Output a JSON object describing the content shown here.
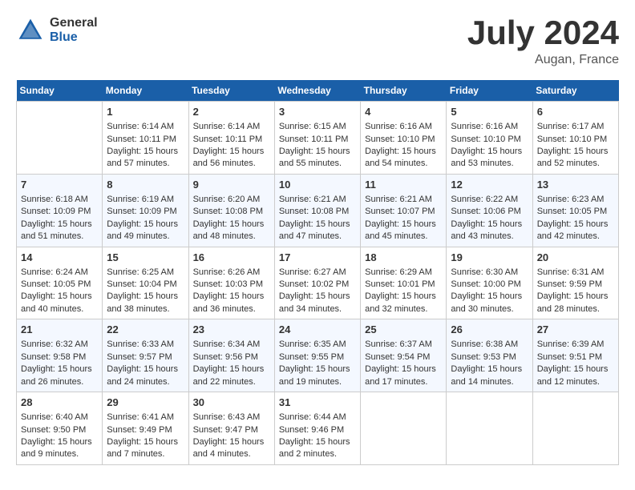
{
  "header": {
    "logo_general": "General",
    "logo_blue": "Blue",
    "month_title": "July 2024",
    "location": "Augan, France"
  },
  "days_of_week": [
    "Sunday",
    "Monday",
    "Tuesday",
    "Wednesday",
    "Thursday",
    "Friday",
    "Saturday"
  ],
  "weeks": [
    [
      {
        "day": "",
        "info": ""
      },
      {
        "day": "1",
        "info": "Sunrise: 6:14 AM\nSunset: 10:11 PM\nDaylight: 15 hours\nand 57 minutes."
      },
      {
        "day": "2",
        "info": "Sunrise: 6:14 AM\nSunset: 10:11 PM\nDaylight: 15 hours\nand 56 minutes."
      },
      {
        "day": "3",
        "info": "Sunrise: 6:15 AM\nSunset: 10:11 PM\nDaylight: 15 hours\nand 55 minutes."
      },
      {
        "day": "4",
        "info": "Sunrise: 6:16 AM\nSunset: 10:10 PM\nDaylight: 15 hours\nand 54 minutes."
      },
      {
        "day": "5",
        "info": "Sunrise: 6:16 AM\nSunset: 10:10 PM\nDaylight: 15 hours\nand 53 minutes."
      },
      {
        "day": "6",
        "info": "Sunrise: 6:17 AM\nSunset: 10:10 PM\nDaylight: 15 hours\nand 52 minutes."
      }
    ],
    [
      {
        "day": "7",
        "info": "Sunrise: 6:18 AM\nSunset: 10:09 PM\nDaylight: 15 hours\nand 51 minutes."
      },
      {
        "day": "8",
        "info": "Sunrise: 6:19 AM\nSunset: 10:09 PM\nDaylight: 15 hours\nand 49 minutes."
      },
      {
        "day": "9",
        "info": "Sunrise: 6:20 AM\nSunset: 10:08 PM\nDaylight: 15 hours\nand 48 minutes."
      },
      {
        "day": "10",
        "info": "Sunrise: 6:21 AM\nSunset: 10:08 PM\nDaylight: 15 hours\nand 47 minutes."
      },
      {
        "day": "11",
        "info": "Sunrise: 6:21 AM\nSunset: 10:07 PM\nDaylight: 15 hours\nand 45 minutes."
      },
      {
        "day": "12",
        "info": "Sunrise: 6:22 AM\nSunset: 10:06 PM\nDaylight: 15 hours\nand 43 minutes."
      },
      {
        "day": "13",
        "info": "Sunrise: 6:23 AM\nSunset: 10:05 PM\nDaylight: 15 hours\nand 42 minutes."
      }
    ],
    [
      {
        "day": "14",
        "info": "Sunrise: 6:24 AM\nSunset: 10:05 PM\nDaylight: 15 hours\nand 40 minutes."
      },
      {
        "day": "15",
        "info": "Sunrise: 6:25 AM\nSunset: 10:04 PM\nDaylight: 15 hours\nand 38 minutes."
      },
      {
        "day": "16",
        "info": "Sunrise: 6:26 AM\nSunset: 10:03 PM\nDaylight: 15 hours\nand 36 minutes."
      },
      {
        "day": "17",
        "info": "Sunrise: 6:27 AM\nSunset: 10:02 PM\nDaylight: 15 hours\nand 34 minutes."
      },
      {
        "day": "18",
        "info": "Sunrise: 6:29 AM\nSunset: 10:01 PM\nDaylight: 15 hours\nand 32 minutes."
      },
      {
        "day": "19",
        "info": "Sunrise: 6:30 AM\nSunset: 10:00 PM\nDaylight: 15 hours\nand 30 minutes."
      },
      {
        "day": "20",
        "info": "Sunrise: 6:31 AM\nSunset: 9:59 PM\nDaylight: 15 hours\nand 28 minutes."
      }
    ],
    [
      {
        "day": "21",
        "info": "Sunrise: 6:32 AM\nSunset: 9:58 PM\nDaylight: 15 hours\nand 26 minutes."
      },
      {
        "day": "22",
        "info": "Sunrise: 6:33 AM\nSunset: 9:57 PM\nDaylight: 15 hours\nand 24 minutes."
      },
      {
        "day": "23",
        "info": "Sunrise: 6:34 AM\nSunset: 9:56 PM\nDaylight: 15 hours\nand 22 minutes."
      },
      {
        "day": "24",
        "info": "Sunrise: 6:35 AM\nSunset: 9:55 PM\nDaylight: 15 hours\nand 19 minutes."
      },
      {
        "day": "25",
        "info": "Sunrise: 6:37 AM\nSunset: 9:54 PM\nDaylight: 15 hours\nand 17 minutes."
      },
      {
        "day": "26",
        "info": "Sunrise: 6:38 AM\nSunset: 9:53 PM\nDaylight: 15 hours\nand 14 minutes."
      },
      {
        "day": "27",
        "info": "Sunrise: 6:39 AM\nSunset: 9:51 PM\nDaylight: 15 hours\nand 12 minutes."
      }
    ],
    [
      {
        "day": "28",
        "info": "Sunrise: 6:40 AM\nSunset: 9:50 PM\nDaylight: 15 hours\nand 9 minutes."
      },
      {
        "day": "29",
        "info": "Sunrise: 6:41 AM\nSunset: 9:49 PM\nDaylight: 15 hours\nand 7 minutes."
      },
      {
        "day": "30",
        "info": "Sunrise: 6:43 AM\nSunset: 9:47 PM\nDaylight: 15 hours\nand 4 minutes."
      },
      {
        "day": "31",
        "info": "Sunrise: 6:44 AM\nSunset: 9:46 PM\nDaylight: 15 hours\nand 2 minutes."
      },
      {
        "day": "",
        "info": ""
      },
      {
        "day": "",
        "info": ""
      },
      {
        "day": "",
        "info": ""
      }
    ]
  ]
}
